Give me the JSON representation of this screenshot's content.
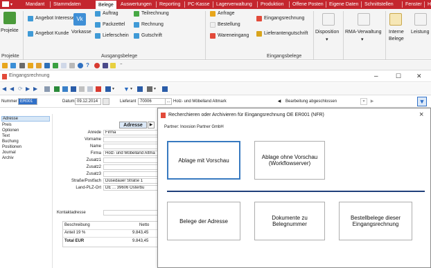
{
  "menubar": {
    "items": [
      "Mandant",
      "Stammdaten",
      "Belege",
      "Auswertungen",
      "Reporting",
      "PC-Kasse",
      "Lagerverwaltung",
      "Produktion",
      "Offene Posten",
      "Eigene Daten",
      "Schnittstellen",
      "Fenster",
      "H"
    ],
    "active_index": 2,
    "bg_color": "#c4262e"
  },
  "ribbon": {
    "projekte_label": "Projekte",
    "angebot_interessent": "Angebot Interessent",
    "angebot_kunde": "Angebot Kunde",
    "vorkasse": "Vorkasse",
    "auftrag": "Auftrag",
    "packzettel": "Packzettel",
    "lieferschein": "Lieferschein",
    "teilrechnung": "Teilrechnung",
    "rechnung": "Rechnung",
    "gutschrift": "Gutschrift",
    "anfrage": "Anfrage",
    "bestellung": "Bestellung",
    "wareneingang": "Wareneingang",
    "eingangsrechnung": "Eingangsrechnung",
    "lieferantengutschrift": "Lieferantengutschrift",
    "disposition": "Disposition",
    "rma_verwaltung": "RMA-Verwaltung",
    "interne_belege_1": "Interne",
    "interne_belege_2": "Belege",
    "leistung": "Leistung",
    "group_projekte": "Projekte",
    "group_ausgangsbelege": "Ausgangsbelege",
    "group_eingangsbelege": "Eingangsbelege"
  },
  "inner_window": {
    "title": "Eingangsrechnung",
    "fields": {
      "nummer_label": "Nummer",
      "nummer_value": "ER001",
      "datum_label": "Datum",
      "datum_value": "09.12.2014",
      "lieferant_label": "Lieferant",
      "lieferant_value": "70006",
      "lieferant_name": "Holz- und Möbelland Altmark",
      "status_value": "Bearbeitung abgeschlossen"
    },
    "nav_items": [
      "Adresse",
      "Preis",
      "Optionen",
      "Text",
      "Buchung",
      "Positionen",
      "Journal",
      "Archiv"
    ],
    "nav_selected_index": 0,
    "address_tab": "Adresse",
    "address_rows": [
      {
        "label": "Anrede",
        "value": "Firma"
      },
      {
        "label": "Vorname",
        "value": ""
      },
      {
        "label": "Name",
        "value": ""
      },
      {
        "label": "Firma",
        "value": "Holz- und Möbelland Altma"
      },
      {
        "label": "Zusatz1",
        "value": ""
      },
      {
        "label": "Zusatz2",
        "value": ""
      },
      {
        "label": "Zusatz3",
        "value": ""
      },
      {
        "label": "Straße/Postfach",
        "value": "Düsedauer Straße 1"
      },
      {
        "label": "Land-PLZ-Ort",
        "value": "DE ... 39606  Osterbu"
      }
    ],
    "kontaktadresse_label": "Kontaktadresse",
    "summary": {
      "col_beschreibung": "Beschreibung",
      "col_netto": "Netto",
      "row1_label": "Anteil 19 %",
      "row1_value": "9.843,45",
      "total_label": "Total EUR",
      "total_value": "9.843,45"
    }
  },
  "dialog": {
    "title": "Recherchieren oder Archivieren für Eingangsrechnung OE ER001 (NFR)",
    "partner": "Partner: Inoxsion Partner GmbH",
    "btn_ablage_vorschau": "Ablage mit Vorschau",
    "btn_ablage_ohne_1": "Ablage ohne Vorschau",
    "btn_ablage_ohne_2": "(Workflowserver)",
    "btn_belege_adresse": "Belege der Adresse",
    "btn_dokumente_1": "Dokumente zu",
    "btn_dokumente_2": "Belegnummer",
    "btn_bestell_1": "Bestellbelege dieser",
    "btn_bestell_2": "Eingangsrechnung",
    "close": "×",
    "divider_color": "#1f3f7a"
  },
  "icons": {
    "window_minimize": "–",
    "window_maximize": "☐",
    "window_close": "✕"
  }
}
